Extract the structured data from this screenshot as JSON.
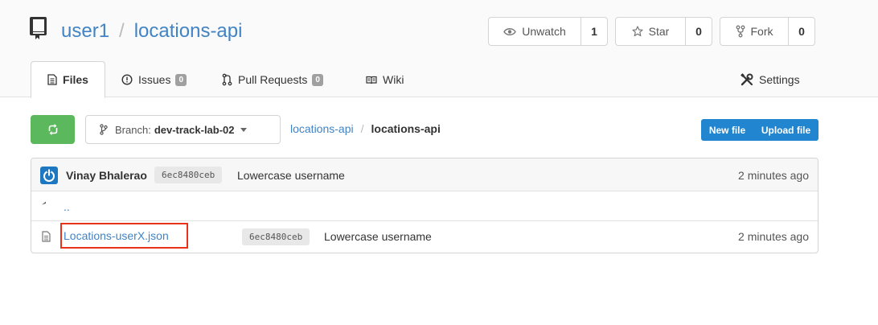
{
  "repo": {
    "owner": "user1",
    "separator": "/",
    "name": "locations-api"
  },
  "actions": {
    "watch": {
      "label": "Unwatch",
      "count": "1"
    },
    "star": {
      "label": "Star",
      "count": "0"
    },
    "fork": {
      "label": "Fork",
      "count": "0"
    }
  },
  "tabs": {
    "files": {
      "label": "Files"
    },
    "issues": {
      "label": "Issues",
      "count": "0"
    },
    "pulls": {
      "label": "Pull Requests",
      "count": "0"
    },
    "wiki": {
      "label": "Wiki"
    },
    "settings": {
      "label": "Settings"
    }
  },
  "toolbar": {
    "branch_prefix": "Branch:",
    "branch_name": "dev-track-lab-02",
    "breadcrumb_root": "locations-api",
    "breadcrumb_sep": "/",
    "breadcrumb_current": "locations-api",
    "new_file": "New file",
    "upload_file": "Upload file"
  },
  "latest_commit": {
    "author": "Vinay Bhalerao",
    "sha": "6ec8480ceb",
    "message": "Lowercase username",
    "time": "2 minutes ago"
  },
  "parent_dir": {
    "label": ".."
  },
  "files": [
    {
      "name": "Locations-userX.json",
      "sha": "6ec8480ceb",
      "message": "Lowercase username",
      "time": "2 minutes ago"
    }
  ],
  "colors": {
    "link": "#4183c4",
    "sync_button": "#5cb85c",
    "primary": "#2185d0",
    "highlight_border": "#e8321c"
  },
  "icons": {
    "repo": "book-icon",
    "watch": "eye-icon",
    "star": "star-icon",
    "fork": "fork-icon",
    "files": "file-text-icon",
    "issues": "issue-icon",
    "pulls": "pull-request-icon",
    "wiki": "book-open-icon",
    "settings": "tools-icon",
    "sync": "sync-icon",
    "branch": "branch-icon",
    "back": "reply-icon",
    "file": "file-icon"
  }
}
